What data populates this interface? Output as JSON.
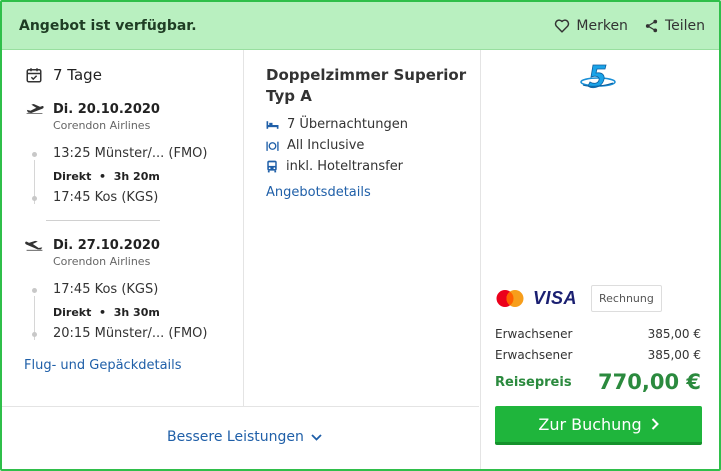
{
  "header": {
    "availability": "Angebot ist verfügbar.",
    "save_label": "Merken",
    "share_label": "Teilen"
  },
  "trip": {
    "duration": "7 Tage",
    "outbound": {
      "date": "Di. 20.10.2020",
      "airline": "Corendon Airlines",
      "depart": "13:25 Münster/...  (FMO)",
      "info_direct": "Direkt",
      "info_duration": "3h 20m",
      "arrive": "17:45 Kos (KGS)"
    },
    "return": {
      "date": "Di. 27.10.2020",
      "airline": "Corendon Airlines",
      "depart": "17:45 Kos (KGS)",
      "info_direct": "Direkt",
      "info_duration": "3h 30m",
      "arrive": "20:15 Münster/...  (FMO)"
    },
    "flight_details_link": "Flug- und Gepäckdetails"
  },
  "room": {
    "title": "Doppelzimmer Superior Typ A",
    "features": [
      "7 Übernachtungen",
      "All Inclusive",
      "inkl. Hoteltransfer"
    ],
    "details_link": "Angebotsdetails"
  },
  "pricing": {
    "payment_invoice": "Rechnung",
    "payment_visa": "VISA",
    "rows": [
      {
        "label": "Erwachsener",
        "amount": "385,00 €"
      },
      {
        "label": "Erwachsener",
        "amount": "385,00 €"
      }
    ],
    "total_label": "Reisepreis",
    "total_amount": "770,00 €",
    "book_label": "Zur Buchung"
  },
  "footer": {
    "better_label": "Bessere Leistungen"
  },
  "colors": {
    "accent_green": "#1fb53c",
    "price_green": "#2b8a3e",
    "link_blue": "#1f5fa8",
    "header_bg": "#b9f0c0"
  }
}
